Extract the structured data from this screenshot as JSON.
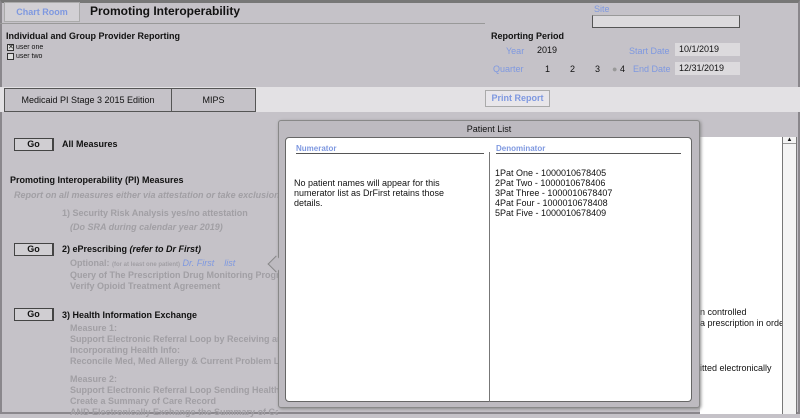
{
  "header": {
    "chart_room": "Chart Room",
    "title": "Promoting Interoperability"
  },
  "provider": {
    "heading": "Individual and Group Provider Reporting",
    "users": [
      {
        "label": "user one",
        "checked": true
      },
      {
        "label": "user two",
        "checked": false
      }
    ]
  },
  "site": {
    "label": "Site",
    "value": ""
  },
  "period": {
    "heading": "Reporting Period",
    "year_label": "Year",
    "year": "2019",
    "quarter_label": "Quarter",
    "quarters": [
      "1",
      "2",
      "3",
      "4"
    ],
    "selected_quarter": "4",
    "start_label": "Start Date",
    "start": "10/1/2019",
    "end_label": "End Date",
    "end": "12/31/2019"
  },
  "tabs": [
    "Medicaid PI Stage 3 2015 Edition",
    "MIPS"
  ],
  "print_report": "Print Report",
  "main": {
    "go": "Go",
    "all_measures": "All Measures",
    "pi_heading": "Promoting Interoperability (PI) Measures",
    "report_note": "Report on all measures either via attestation or take exclusion",
    "m1": "1) Security Risk Analysis yes/no attestation",
    "m1_note": "(Do SRA during calendar year 2019)",
    "m2": "2) ePrescribing",
    "m2_ref": "(refer to Dr First)",
    "m2_optional": "Optional:",
    "m2_optional_note": "(for at least one patient)",
    "m2_link1": "Dr. First",
    "m2_link2": "list",
    "m2_lines": [
      "Query of The Prescription Drug Monitoring Progr",
      "Verify Opioid Treatment Agreement"
    ],
    "m3": "3) Health Information Exchange",
    "m3_lines1": [
      "Measure 1:",
      "Support Electronic Referral Loop by Receiving an",
      "Incorporating Health Info:",
      "Reconcile Med, Med Allergy & Current Problem L"
    ],
    "m3_lines2": [
      "Measure 2:",
      "Support Electronic Referral Loop Sending Health",
      "Create a Summary of Care Record",
      "AND Electronically Exchange the Summary of Care"
    ]
  },
  "right_text": [
    "n controlled",
    "a prescription in order",
    "itted electronically"
  ],
  "popup": {
    "title": "Patient List",
    "numerator_label": "Numerator",
    "numerator_text": "No patient names will appear for this numerator list as DrFirst retains those details.",
    "denominator_label": "Denominator",
    "patients": [
      "1Pat One - 1000010678405",
      "2Pat Two - 1000010678406",
      "3Pat Three - 1000010678407",
      "4Pat Four - 1000010678408",
      "5Pat Five - 1000010678409"
    ]
  }
}
